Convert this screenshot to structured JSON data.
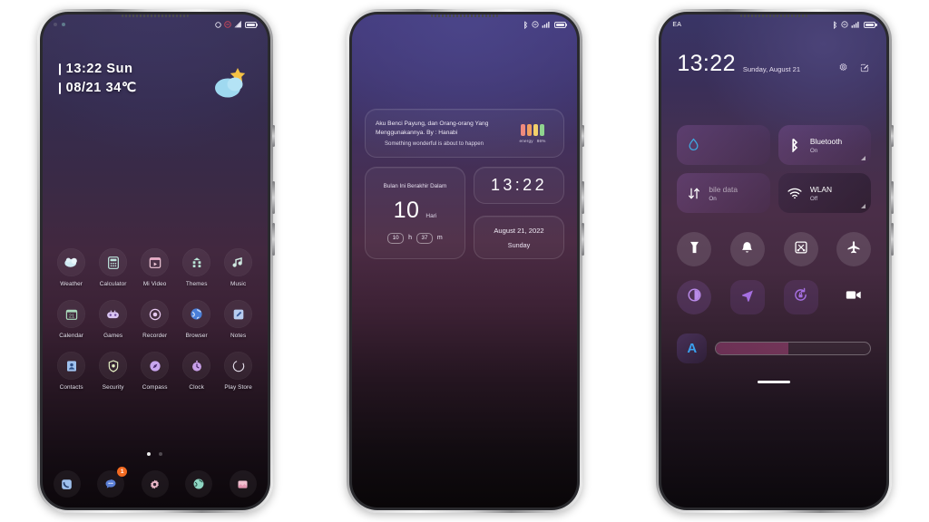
{
  "scene": {
    "background_color": "#ffffff",
    "phone_count": 3,
    "theme_accent": "#8b5fb0"
  },
  "phone1": {
    "label": "home-screen",
    "statusbar": {
      "camera_dots": [
        "camera-dot",
        "camera-dot-lit"
      ],
      "icons": [
        "alarm-icon",
        "dnd-icon",
        "signal-icon",
        "battery-icon"
      ]
    },
    "clock_widget": {
      "line1": "13:22 Sun",
      "line2": "08/21 34℃"
    },
    "weather_icon": "sun-behind-cloud-icon",
    "app_rows": [
      [
        {
          "label": "Weather",
          "icon": "weather-cloud-icon",
          "shape": "round"
        },
        {
          "label": "Calculator",
          "icon": "calculator-icon",
          "shape": "round"
        },
        {
          "label": "Mi Video",
          "icon": "video-player-icon",
          "shape": "round"
        },
        {
          "label": "Themes",
          "icon": "themes-icon",
          "shape": "round"
        },
        {
          "label": "Music",
          "icon": "music-note-icon",
          "shape": "round"
        }
      ],
      [
        {
          "label": "Calendar",
          "icon": "calendar-icon",
          "shape": "round"
        },
        {
          "label": "Games",
          "icon": "game-controller-icon",
          "shape": "round"
        },
        {
          "label": "Recorder",
          "icon": "recorder-icon",
          "shape": "round"
        },
        {
          "label": "Browser",
          "icon": "globe-icon",
          "shape": "round"
        },
        {
          "label": "Notes",
          "icon": "notes-pencil-icon",
          "shape": "round"
        }
      ],
      [
        {
          "label": "Contacts",
          "icon": "contacts-icon",
          "shape": "round"
        },
        {
          "label": "Security",
          "icon": "shield-icon",
          "shape": "round"
        },
        {
          "label": "Compass",
          "icon": "compass-icon",
          "shape": "round"
        },
        {
          "label": "Clock",
          "icon": "clock-icon",
          "shape": "round"
        },
        {
          "label": "Play Store",
          "icon": "play-store-icon",
          "shape": "round"
        }
      ]
    ],
    "page_dots": {
      "count": 2,
      "active_index": 0
    },
    "dock": [
      {
        "name": "phone-app",
        "icon": "phone-handset-icon",
        "badge": null
      },
      {
        "name": "messages-app",
        "icon": "message-bubble-icon",
        "badge": "1"
      },
      {
        "name": "settings-app",
        "icon": "gear-icon",
        "badge": null
      },
      {
        "name": "browser-app",
        "icon": "globe-icon",
        "badge": null
      },
      {
        "name": "gallery-app",
        "icon": "gallery-icon",
        "badge": null
      }
    ]
  },
  "phone2": {
    "label": "widget-screen",
    "statusbar": {
      "icons": [
        "bluetooth-icon",
        "dnd-icon",
        "signal-icon",
        "battery-icon"
      ]
    },
    "quote_widget": {
      "quote": "Aku Benci Payung, dan Orang-orang Yang Menggunakannya. By : Hanabi",
      "subtitle": "Something wonderful is about to happen",
      "energy_label": "energy",
      "energy_value": "86%",
      "bar_colors": [
        "#ef8a7d",
        "#f0a060",
        "#f2d06a",
        "#8fd48f"
      ]
    },
    "countdown_widget": {
      "title": "Bulan Ini Berakhir Dalam",
      "days": "10",
      "days_unit": "Hari",
      "hours": "10",
      "hours_unit": "h",
      "minutes": "37",
      "minutes_unit": "m"
    },
    "time_widget": {
      "time": "13:22"
    },
    "date_widget": {
      "date": "August 21, 2022",
      "weekday": "Sunday"
    }
  },
  "phone3": {
    "label": "control-center",
    "statusbar": {
      "carrier": "EA",
      "icons": [
        "bluetooth-icon",
        "dnd-icon",
        "signal-icon",
        "battery-icon"
      ]
    },
    "header": {
      "time": "13:22",
      "date": "Sunday, August 21",
      "settings_icon": "gear-icon",
      "edit_icon": "edit-pencil-icon"
    },
    "tiles": [
      {
        "name": "water-drop-tile",
        "icon": "water-drop-icon",
        "label": "",
        "state": "",
        "active": true,
        "corner": false,
        "faded": true
      },
      {
        "name": "bluetooth-tile",
        "icon": "bluetooth-icon",
        "label": "Bluetooth",
        "state": "On",
        "active": true,
        "corner": true,
        "faded": false
      },
      {
        "name": "mobile-data-tile",
        "icon": "data-transfer-icon",
        "label": "bile data",
        "state": "On",
        "active": true,
        "corner": false,
        "faded": true
      },
      {
        "name": "wlan-tile",
        "icon": "wifi-icon",
        "label": "WLAN",
        "state": "Off",
        "active": false,
        "corner": true,
        "faded": false
      }
    ],
    "toggles_row1": [
      {
        "name": "flashlight-toggle",
        "icon": "flashlight-icon"
      },
      {
        "name": "ringer-toggle",
        "icon": "bell-icon"
      },
      {
        "name": "screenshot-toggle",
        "icon": "screenshot-icon"
      },
      {
        "name": "airplane-toggle",
        "icon": "airplane-icon"
      }
    ],
    "toggles_row2": [
      {
        "name": "dark-mode-toggle",
        "icon": "contrast-circle-icon"
      },
      {
        "name": "location-toggle",
        "icon": "location-arrow-icon"
      },
      {
        "name": "rotation-lock-toggle",
        "icon": "rotation-lock-icon"
      },
      {
        "name": "screen-recorder-toggle",
        "icon": "video-camera-icon"
      }
    ],
    "brightness": {
      "auto_label": "A",
      "fill_percent": "47"
    },
    "home_indicator": "home-bar"
  }
}
